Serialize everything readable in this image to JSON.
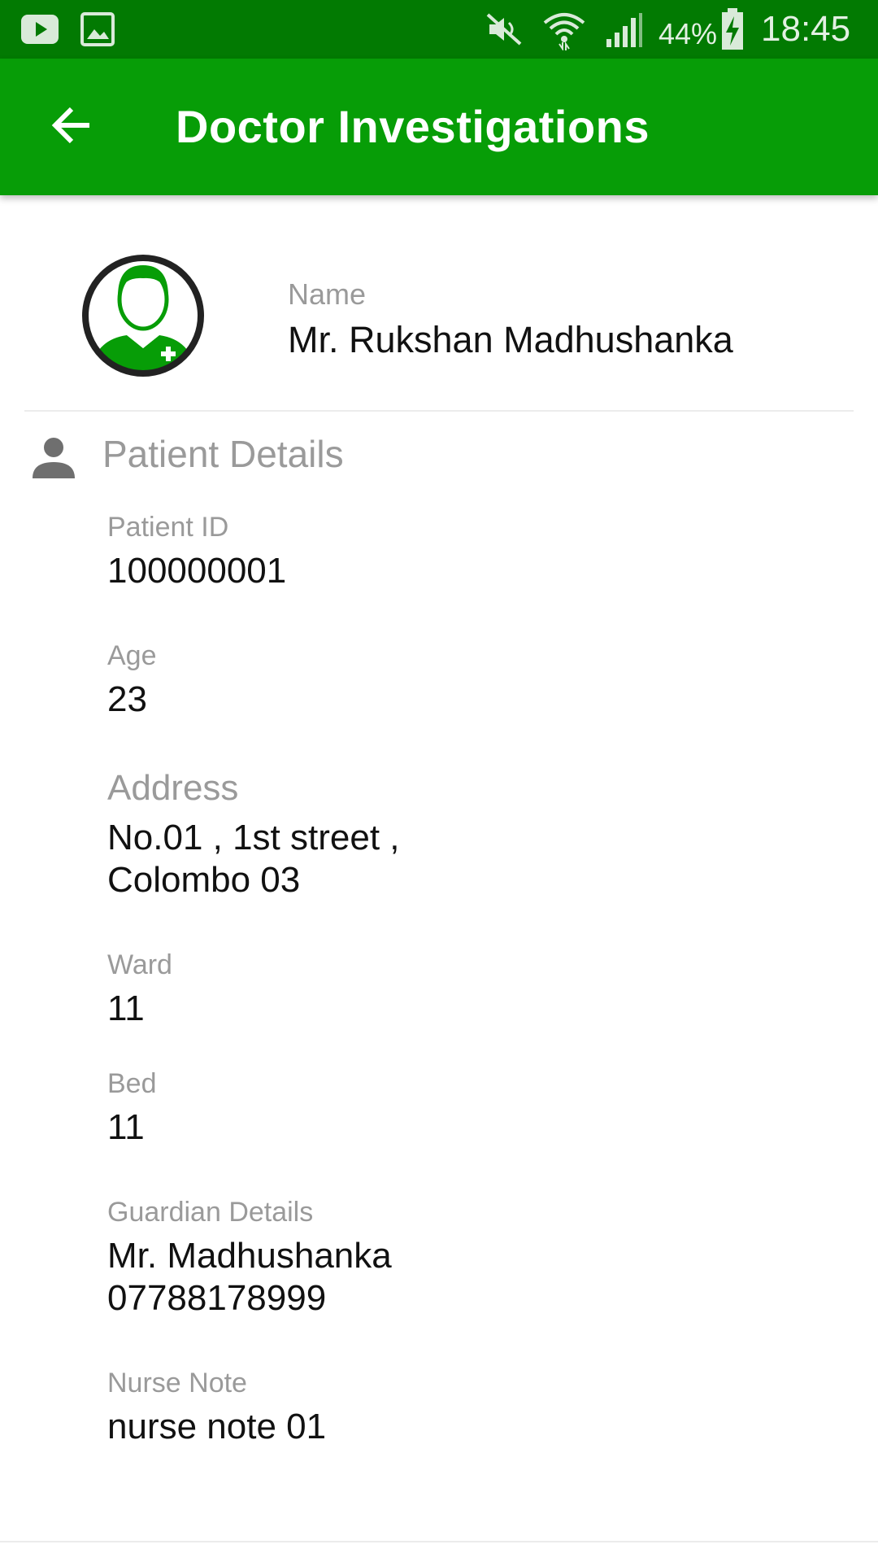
{
  "status_bar": {
    "left_icons": [
      "youtube-icon",
      "gallery-icon"
    ],
    "right_icons": [
      "mute-icon",
      "wifi-icon",
      "signal-icon",
      "battery-charging-icon"
    ],
    "battery": "44%",
    "time": "18:45"
  },
  "app_bar": {
    "back_icon": "arrow-left-icon",
    "title": "Doctor Investigations"
  },
  "profile": {
    "avatar_icon": "doctor-avatar-icon",
    "name_label": "Name",
    "name": "Mr. Rukshan Madhushanka"
  },
  "patient_details": {
    "icon": "person-icon",
    "title": "Patient Details",
    "fields": [
      {
        "label": "Patient ID",
        "value": "100000001"
      },
      {
        "label": "Age",
        "value": "23"
      },
      {
        "label": "Address",
        "value": "No.01 , 1st street ,\nColombo 03"
      },
      {
        "label": "Ward",
        "value": "11"
      },
      {
        "label": "Bed",
        "value": "11"
      },
      {
        "label": "Guardian Details",
        "value": "Mr. Madhushanka\n07788178999"
      },
      {
        "label": "Nurse Note",
        "value": "nurse note 01"
      }
    ]
  },
  "colors": {
    "status_bar": "#027a02",
    "app_bar": "#079d07",
    "label_gray": "#9a9a9a"
  }
}
